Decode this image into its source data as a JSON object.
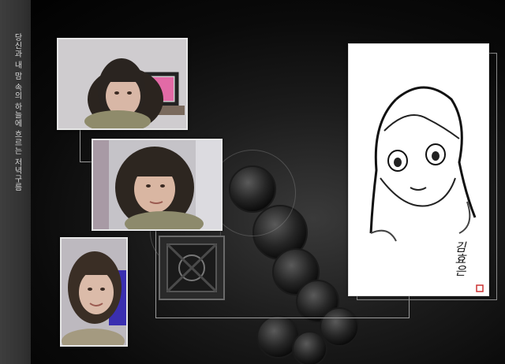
{
  "sidebar": {
    "vertical_text": "당신과 내 맘 속의 하늘에 흐르는 저녁구름"
  },
  "photos": [
    {
      "name": "photo-top",
      "alt": "portrait by monitor"
    },
    {
      "name": "photo-middle",
      "alt": "portrait close-up"
    },
    {
      "name": "photo-bottom",
      "alt": "portrait smile"
    }
  ],
  "sketch": {
    "signature": "김효은"
  },
  "colors": {
    "background": "#000000",
    "sidebar": "#363636",
    "frame_border": "#e6e6e6",
    "connector": "#9a9a9a"
  }
}
